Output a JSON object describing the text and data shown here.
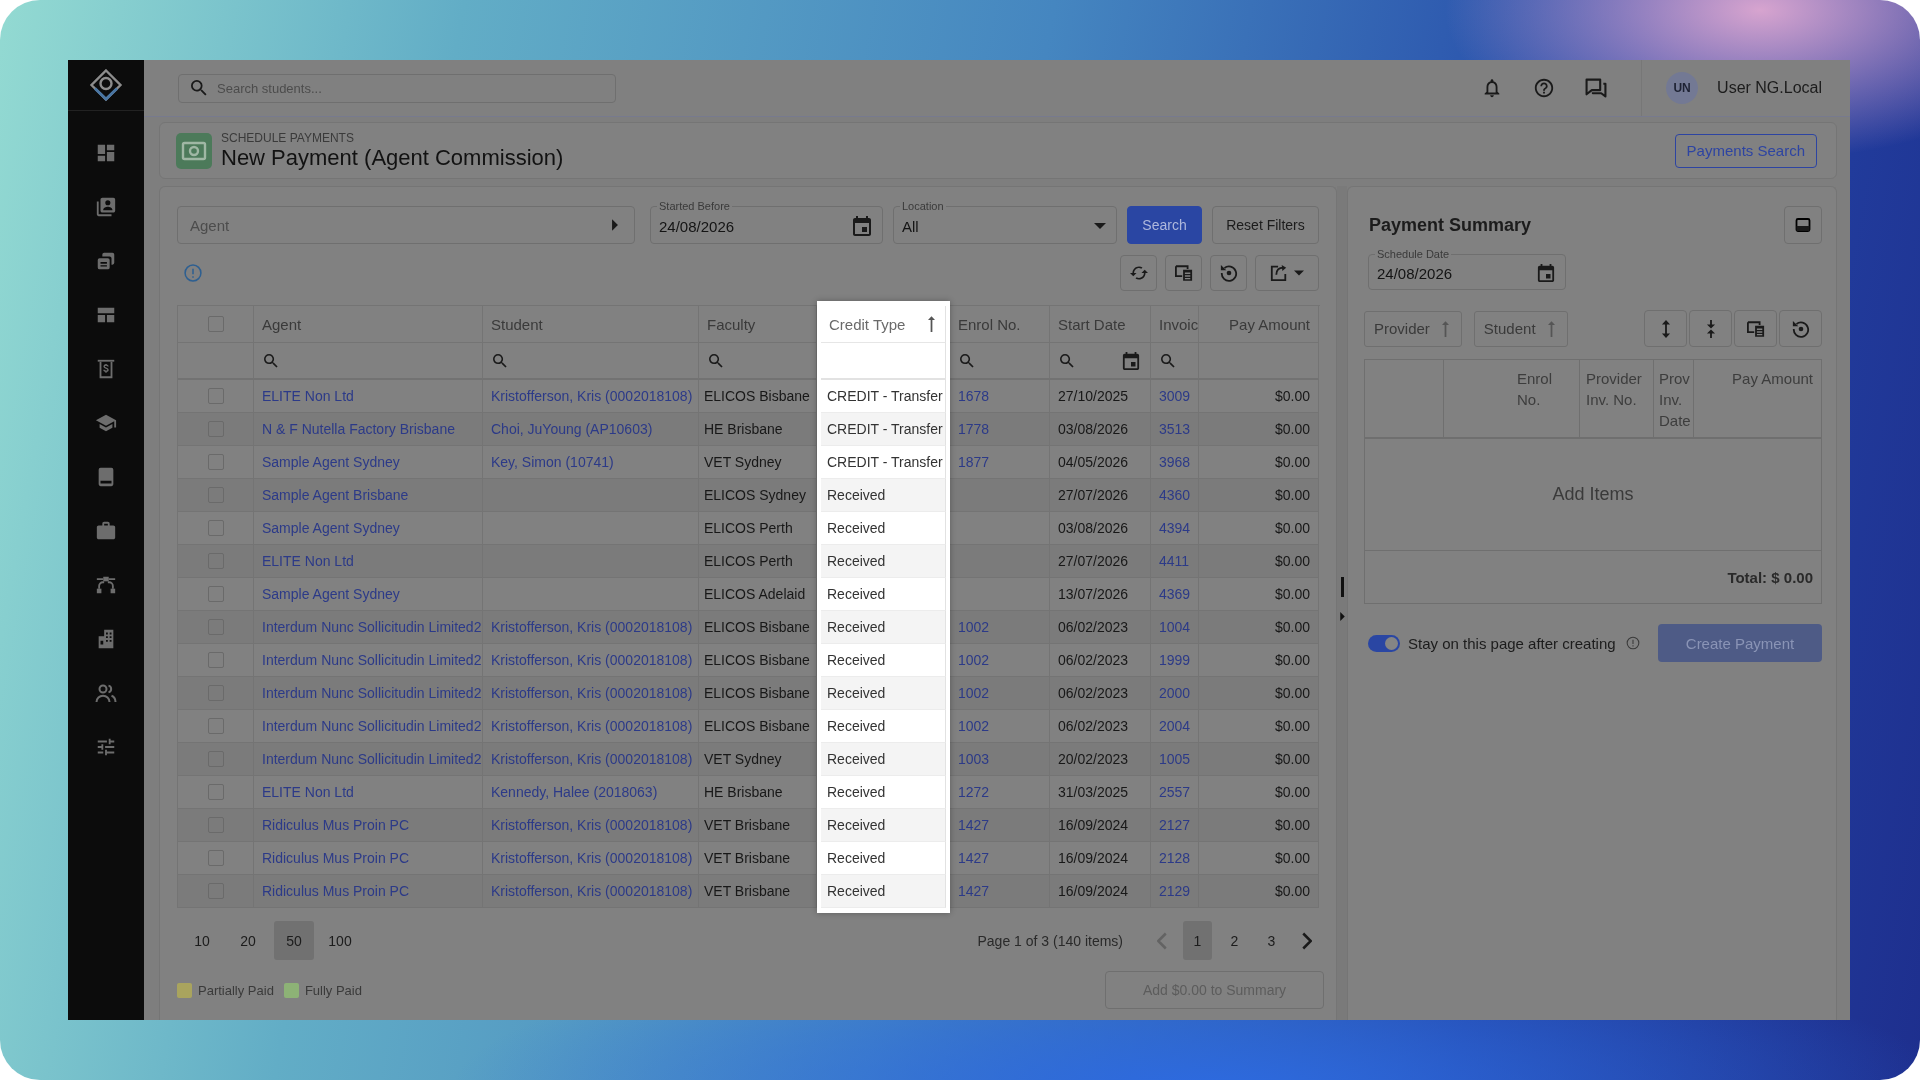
{
  "topbar": {
    "search": {
      "placeholder": "Search students..."
    },
    "user": {
      "initials": "UN",
      "name": "User NG.Local"
    }
  },
  "page_header": {
    "section": "SCHEDULE PAYMENTS",
    "title": "New Payment (Agent Commission)",
    "button": "Payments Search"
  },
  "filters": {
    "agent": {
      "placeholder": "Agent"
    },
    "started_before": {
      "label": "Started Before",
      "value": "24/08/2026"
    },
    "location": {
      "label": "Location",
      "value": "All"
    },
    "buttons": [
      {
        "label": "Search",
        "kind": "primary"
      },
      {
        "label": "Reset Filters",
        "kind": "outline"
      }
    ]
  },
  "table": {
    "select_all": {
      "checked": false
    },
    "columns": [
      {
        "label": "Agent",
        "kind": "link",
        "filter": {
          "kind": "search"
        },
        "sorted": false,
        "highlighted": false
      },
      {
        "label": "Student",
        "kind": "link",
        "filter": {
          "kind": "search"
        },
        "sorted": false,
        "highlighted": false
      },
      {
        "label": "Faculty",
        "kind": "text",
        "filter": {
          "kind": "search"
        },
        "sorted": false,
        "highlighted": false
      },
      {
        "label": "Credit Type",
        "kind": "text",
        "filter": {
          "kind": "none"
        },
        "sorted": true,
        "highlighted": true
      },
      {
        "label": "Enrol No.",
        "kind": "link",
        "filter": {
          "kind": "search"
        },
        "sorted": false,
        "highlighted": false
      },
      {
        "label": "Start Date",
        "kind": "text",
        "filter": {
          "kind": "date"
        },
        "sorted": false,
        "highlighted": false
      },
      {
        "label": "Invoic",
        "kind": "link",
        "filter": {
          "kind": "search"
        },
        "sorted": false,
        "highlighted": false
      },
      {
        "label": "Pay Amount",
        "kind": "amount",
        "filter": {
          "kind": "none"
        },
        "sorted": false,
        "highlighted": false
      }
    ],
    "rows": [
      {
        "checked": false,
        "cells": [
          "ELITE Non Ltd",
          "Kristofferson, Kris (0002018108)",
          "ELICOS Bisbane",
          "CREDIT - Transfer",
          "1678",
          "27/10/2025",
          "3009",
          "$0.00"
        ]
      },
      {
        "checked": false,
        "cells": [
          "N & F Nutella Factory Brisbane",
          "Choi, JuYoung (AP10603)",
          "HE Brisbane",
          "CREDIT - Transfer",
          "1778",
          "03/08/2026",
          "3513",
          "$0.00"
        ]
      },
      {
        "checked": false,
        "cells": [
          "Sample Agent Sydney",
          "Key, Simon (10741)",
          "VET Sydney",
          "CREDIT - Transfer",
          "1877",
          "04/05/2026",
          "3968",
          "$0.00"
        ]
      },
      {
        "checked": false,
        "cells": [
          "Sample Agent Brisbane",
          null,
          "ELICOS Sydney",
          "Received",
          null,
          "27/07/2026",
          "4360",
          "$0.00"
        ]
      },
      {
        "checked": false,
        "cells": [
          "Sample Agent Sydney",
          null,
          "ELICOS Perth",
          "Received",
          null,
          "03/08/2026",
          "4394",
          "$0.00"
        ]
      },
      {
        "checked": false,
        "cells": [
          "ELITE Non Ltd",
          null,
          "ELICOS Perth",
          "Received",
          null,
          "27/07/2026",
          "4411",
          "$0.00"
        ]
      },
      {
        "checked": false,
        "cells": [
          "Sample Agent Sydney",
          null,
          "ELICOS Adelaid",
          "Received",
          null,
          "13/07/2026",
          "4369",
          "$0.00"
        ]
      },
      {
        "checked": false,
        "cells": [
          "Interdum Nunc Sollicitudin Limited2",
          "Kristofferson, Kris (0002018108)",
          "ELICOS Bisbane",
          "Received",
          "1002",
          "06/02/2023",
          "1004",
          "$0.00"
        ]
      },
      {
        "checked": false,
        "cells": [
          "Interdum Nunc Sollicitudin Limited2",
          "Kristofferson, Kris (0002018108)",
          "ELICOS Bisbane",
          "Received",
          "1002",
          "06/02/2023",
          "1999",
          "$0.00"
        ]
      },
      {
        "checked": false,
        "cells": [
          "Interdum Nunc Sollicitudin Limited2",
          "Kristofferson, Kris (0002018108)",
          "ELICOS Bisbane",
          "Received",
          "1002",
          "06/02/2023",
          "2000",
          "$0.00"
        ]
      },
      {
        "checked": false,
        "cells": [
          "Interdum Nunc Sollicitudin Limited2",
          "Kristofferson, Kris (0002018108)",
          "ELICOS Bisbane",
          "Received",
          "1002",
          "06/02/2023",
          "2004",
          "$0.00"
        ]
      },
      {
        "checked": false,
        "cells": [
          "Interdum Nunc Sollicitudin Limited2",
          "Kristofferson, Kris (0002018108)",
          "VET Sydney",
          "Received",
          "1003",
          "20/02/2023",
          "1005",
          "$0.00"
        ]
      },
      {
        "checked": false,
        "cells": [
          "ELITE Non Ltd",
          "Kennedy, Halee (2018063)",
          "HE Brisbane",
          "Received",
          "1272",
          "31/03/2025",
          "2557",
          "$0.00"
        ]
      },
      {
        "checked": false,
        "cells": [
          "Ridiculus Mus Proin PC",
          "Kristofferson, Kris (0002018108)",
          "VET Brisbane",
          "Received",
          "1427",
          "16/09/2024",
          "2127",
          "$0.00"
        ]
      },
      {
        "checked": false,
        "cells": [
          "Ridiculus Mus Proin PC",
          "Kristofferson, Kris (0002018108)",
          "VET Brisbane",
          "Received",
          "1427",
          "16/09/2024",
          "2128",
          "$0.00"
        ]
      },
      {
        "checked": false,
        "cells": [
          "Ridiculus Mus Proin PC",
          "Kristofferson, Kris (0002018108)",
          "VET Brisbane",
          "Received",
          "1427",
          "16/09/2024",
          "2129",
          "$0.00"
        ]
      }
    ]
  },
  "pagination": {
    "page_sizes": [
      {
        "label": "10",
        "selected": false
      },
      {
        "label": "20",
        "selected": false
      },
      {
        "label": "50",
        "selected": true
      },
      {
        "label": "100",
        "selected": false
      }
    ],
    "summary": "Page 1 of 3 (140 items)",
    "prev": {
      "disabled": true
    },
    "pages": [
      {
        "label": "1",
        "selected": true
      },
      {
        "label": "2",
        "selected": false
      },
      {
        "label": "3",
        "selected": false
      }
    ],
    "next": {
      "disabled": false
    }
  },
  "legend": [
    {
      "label": "Partially Paid",
      "color": "#a9a45e"
    },
    {
      "label": "Fully Paid",
      "color": "#8db276"
    }
  ],
  "add_button": {
    "label": "Add $0.00 to Summary",
    "disabled": true
  },
  "payment_summary": {
    "title": "Payment Summary",
    "schedule_date": {
      "label": "Schedule Date",
      "value": "24/08/2026"
    },
    "sort_chips": [
      "Provider",
      "Student"
    ],
    "columns": [
      "Enrol No.",
      "Provider Inv. No.",
      "Prov Inv. Date",
      "Pay Amount"
    ],
    "empty_text": "Add Items",
    "total": "Total: $ 0.00",
    "stay_toggle": {
      "label": "Stay on this page after creating",
      "on": true
    },
    "create_button": {
      "label": "Create Payment",
      "disabled": true
    }
  }
}
